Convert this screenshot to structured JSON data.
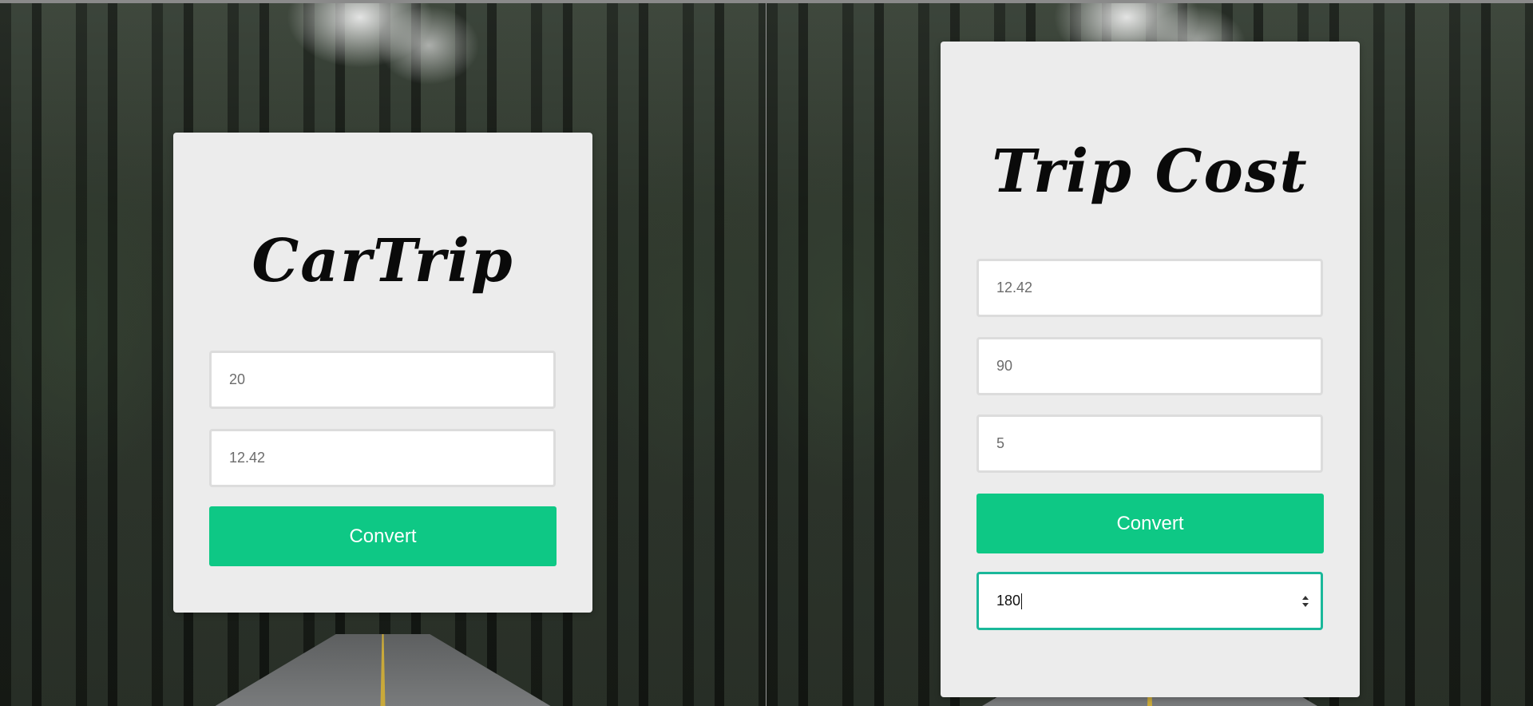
{
  "left_app": {
    "title": "CarTrip",
    "fields": [
      {
        "value": "20"
      },
      {
        "value": "12.42"
      }
    ],
    "convert_label": "Convert"
  },
  "right_app": {
    "title": "Trip Cost",
    "fields": [
      {
        "value": "12.42"
      },
      {
        "value": "90"
      },
      {
        "value": "5"
      }
    ],
    "convert_label": "Convert",
    "result_value": "180"
  },
  "colors": {
    "button": "#0ec885",
    "card": "#ececec",
    "focus_border": "#1ab89a"
  }
}
